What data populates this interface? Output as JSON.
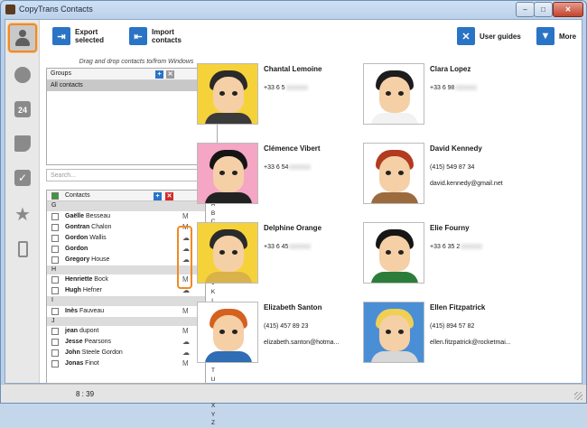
{
  "window": {
    "title": "CopyTrans Contacts",
    "minimize": "–",
    "maximize": "□",
    "close": "✕"
  },
  "toolbar": {
    "export_label": "Export\nselected",
    "import_label": "Import\ncontacts",
    "guides_label": "User guides",
    "more_label": "More"
  },
  "drag_hint": "Drag and drop contacts to/from Windows",
  "groups": {
    "header": "Groups",
    "items": [
      "All contacts"
    ]
  },
  "search": {
    "placeholder": "Search..."
  },
  "contacts_list": {
    "header": "Contacts",
    "sections": [
      {
        "letter": "G",
        "rows": [
          {
            "first": "Gaëlle",
            "last": "Besseau",
            "icon": "M"
          },
          {
            "first": "Gontran",
            "last": "Chalon",
            "icon": "M"
          },
          {
            "first": "Gordon",
            "last": "Wallis",
            "icon": "☁"
          },
          {
            "first": "Gordon",
            "last": "",
            "icon": "☁"
          },
          {
            "first": "Gregory",
            "last": "House",
            "icon": "☁"
          }
        ]
      },
      {
        "letter": "H",
        "rows": [
          {
            "first": "Henriette",
            "last": "Bock",
            "icon": "M"
          },
          {
            "first": "Hugh",
            "last": "Hefner",
            "icon": "☁"
          }
        ]
      },
      {
        "letter": "I",
        "rows": [
          {
            "first": "Inès",
            "last": "Fauveau",
            "icon": "M"
          }
        ]
      },
      {
        "letter": "J",
        "rows": [
          {
            "first": "jean",
            "last": "dupont",
            "icon": "M"
          },
          {
            "first": "Jesse",
            "last": "Pearsons",
            "icon": "☁"
          },
          {
            "first": "John",
            "last": "Steele Gordon",
            "icon": "☁"
          },
          {
            "first": "Jonas",
            "last": "Finot",
            "icon": "M"
          }
        ]
      }
    ]
  },
  "alphabet": [
    "AZ",
    "A",
    "B",
    "C",
    "D",
    "E",
    "F",
    "G",
    "H",
    "I",
    "J",
    "K",
    "L",
    "M",
    "N",
    "O",
    "P",
    "Q",
    "R",
    "S",
    "T",
    "U",
    "V",
    "W",
    "X",
    "Y",
    "Z"
  ],
  "cards": [
    {
      "name": "Chantal Lemoine",
      "phone": "+33 6 5",
      "email": "",
      "bg": "#f6d23a",
      "hair": "#2a2a2a",
      "shirt": "#3b3b3b"
    },
    {
      "name": "Clara Lopez",
      "phone": "+33 6 98",
      "email": "",
      "bg": "#ffffff",
      "hair": "#1c1c1c",
      "shirt": "#f2f2f2"
    },
    {
      "name": "Clémence Vibert",
      "phone": "+33 6 54",
      "email": "",
      "bg": "#f4a6c4",
      "hair": "#141414",
      "shirt": "#222222"
    },
    {
      "name": "David Kennedy",
      "phone": "(415) 549 87 34",
      "email": "david.kennedy@gmail.net",
      "bg": "#ffffff",
      "hair": "#b23a1e",
      "shirt": "#9b6b3e"
    },
    {
      "name": "Delphine Orange",
      "phone": "+33 6 45",
      "email": "",
      "bg": "#f6d23a",
      "hair": "#2a2a2a",
      "shirt": "#d9b24a"
    },
    {
      "name": "Elie Fourny",
      "phone": "+33 6 35 2",
      "email": "",
      "bg": "#ffffff",
      "hair": "#161616",
      "shirt": "#2d7d3a"
    },
    {
      "name": "Elizabeth Santon",
      "phone": "(415) 457 89 23",
      "email": "elizabeth.santon@hotma...",
      "bg": "#ffffff",
      "hair": "#d4611f",
      "shirt": "#2f6db5"
    },
    {
      "name": "Ellen Fitzpatrick",
      "phone": "(415) 894 57 82",
      "email": "ellen.fitzpatrick@rocketmai...",
      "bg": "#4a8fd6",
      "hair": "#f0d054",
      "shirt": "#d7d7d7"
    }
  ],
  "status": {
    "text": "8 : 39"
  },
  "colors": {
    "accent": "#f08a24",
    "primary": "#2a74c6"
  }
}
